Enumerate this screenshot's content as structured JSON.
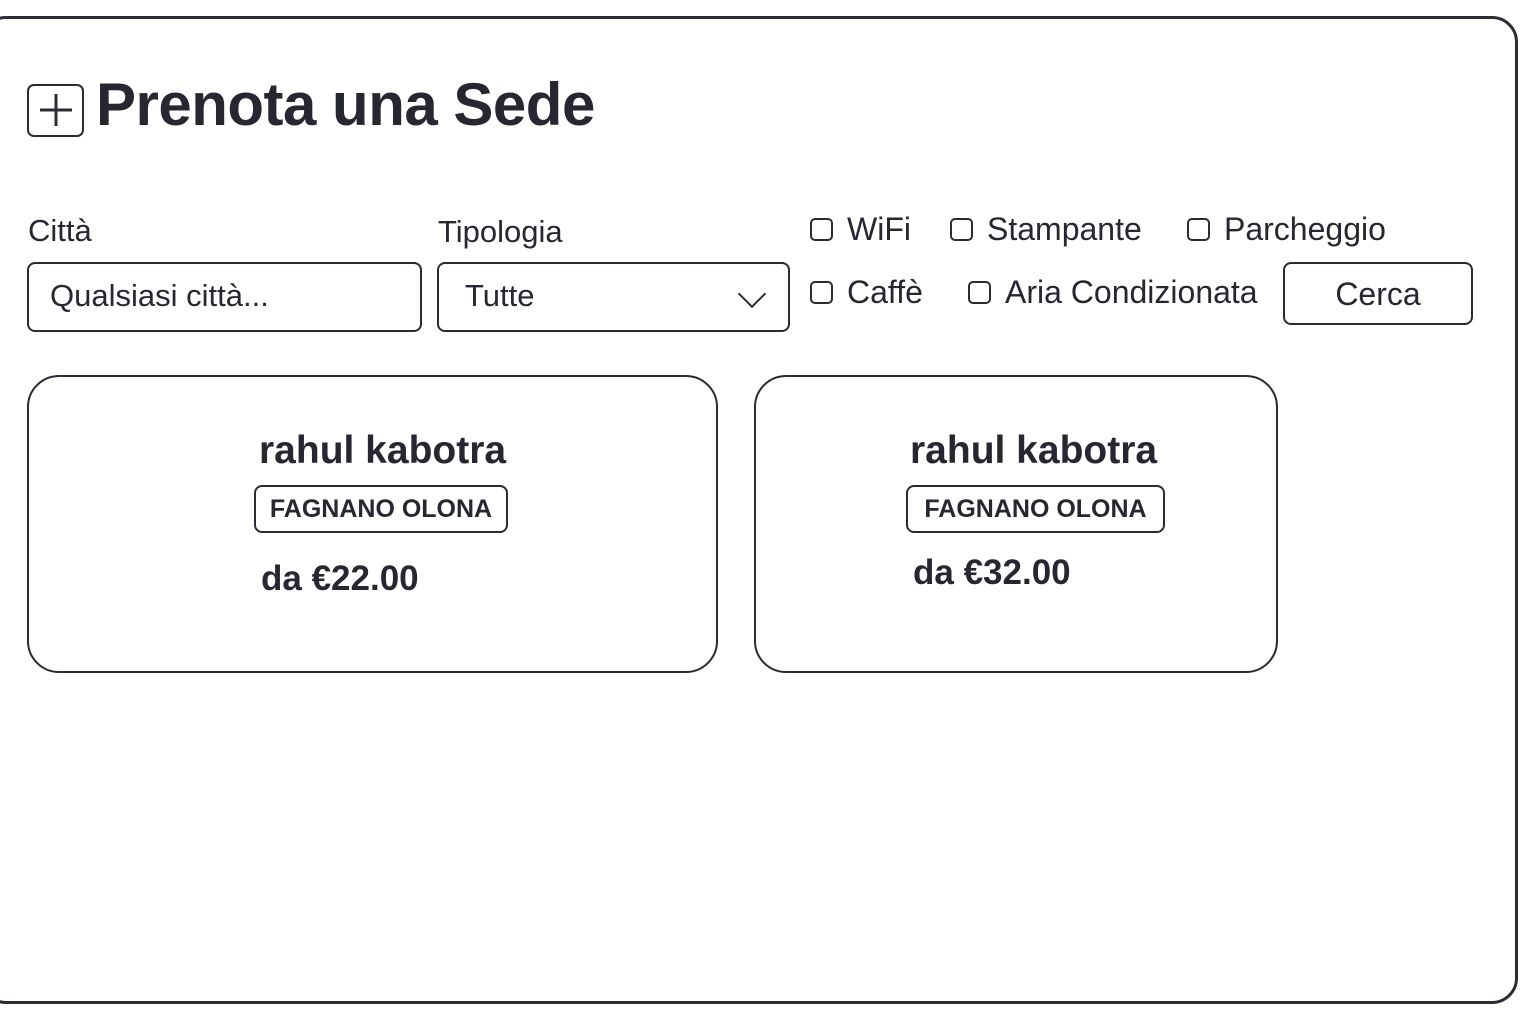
{
  "header": {
    "title": "Prenota una Sede",
    "icon": "plus-square-icon"
  },
  "filters": {
    "city_label": "Città",
    "city_value": "",
    "city_placeholder": "Qualsiasi città...",
    "type_label": "Tipologia",
    "type_selected": "Tutte",
    "amenities": [
      {
        "label": "WiFi",
        "checked": false
      },
      {
        "label": "Stampante",
        "checked": false
      },
      {
        "label": "Parcheggio",
        "checked": false
      },
      {
        "label": "Caffè",
        "checked": false
      },
      {
        "label": "Aria Condizionata",
        "checked": false
      }
    ],
    "search_label": "Cerca"
  },
  "results": [
    {
      "name": "rahul kabotra",
      "city": "FAGNANO OLONA",
      "price": "da €22.00"
    },
    {
      "name": "rahul kabotra",
      "city": "FAGNANO OLONA",
      "price": "da €32.00"
    }
  ]
}
